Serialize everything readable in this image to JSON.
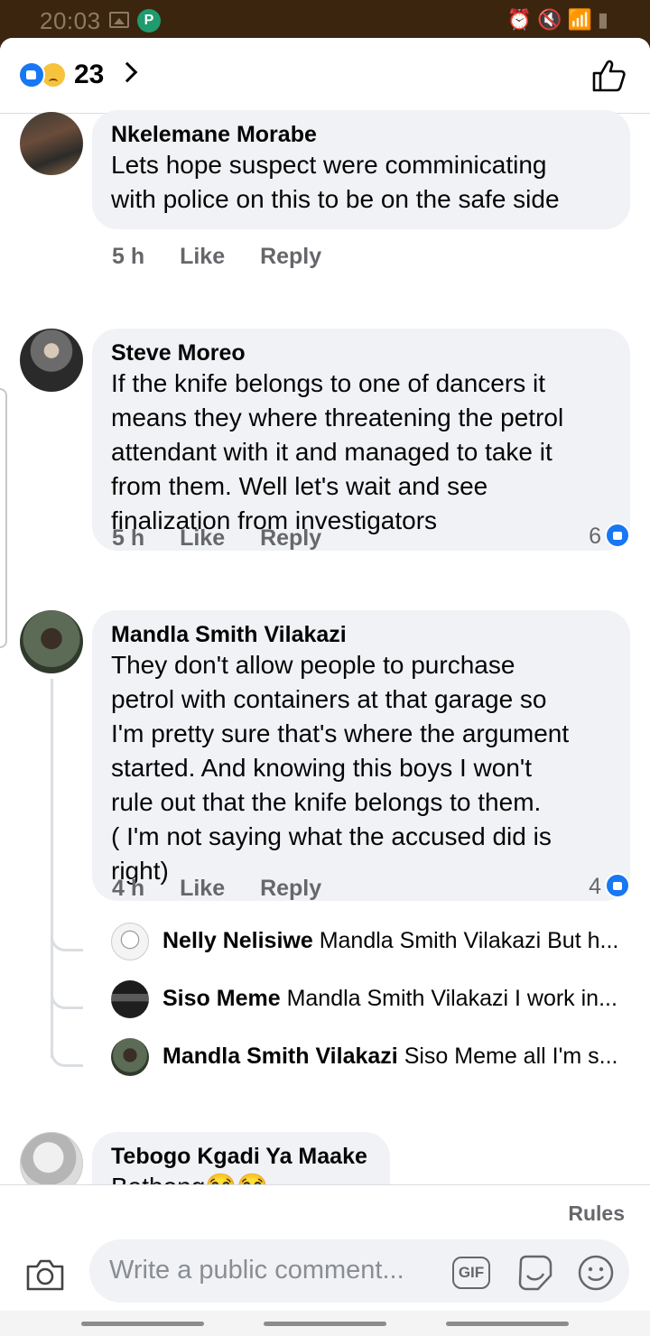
{
  "status": {
    "time": "20:03"
  },
  "header": {
    "reaction_count": "23"
  },
  "comments": [
    {
      "author": "Nkelemane Morabe",
      "lines": [
        "Lets hope suspect were comminicating",
        "with police on this to be on the safe side"
      ],
      "time": "5 h",
      "like": "Like",
      "reply": "Reply"
    },
    {
      "author": "Steve Moreo",
      "lines": [
        "If the knife belongs to one of dancers it",
        "means they where threatening the petrol",
        "attendant with it and managed to take it",
        "from them. Well let's wait and see",
        "finalization from investigators"
      ],
      "time": "5 h",
      "like": "Like",
      "reply": "Reply",
      "reactions": "6"
    },
    {
      "author": "Mandla Smith Vilakazi",
      "lines": [
        "They don't allow people to purchase",
        "petrol with containers at that garage so",
        "I'm pretty sure that's where the argument",
        "started. And knowing this boys I won't",
        "rule out that the knife belongs to them.",
        "( I'm not saying what the accused did is",
        "right)"
      ],
      "time": "4 h",
      "like": "Like",
      "reply": "Reply",
      "reactions": "4",
      "replies": [
        {
          "author": "Nelly Nelisiwe",
          "text": "Mandla Smith Vilakazi But h..."
        },
        {
          "author": "Siso Meme",
          "text": "Mandla Smith Vilakazi I  work in..."
        },
        {
          "author": "Mandla Smith Vilakazi",
          "text": "Siso Meme all I'm s..."
        }
      ]
    },
    {
      "author": "Tebogo Kgadi Ya Maake",
      "text": "Bathong😭😭"
    }
  ],
  "footer": {
    "rules": "Rules",
    "placeholder": "Write a public comment...",
    "gif": "GIF"
  },
  "colors": {
    "accent": "#1877f2",
    "bubble": "#f0f2f5",
    "meta": "#65676b",
    "statusbar": "#3b250f"
  }
}
